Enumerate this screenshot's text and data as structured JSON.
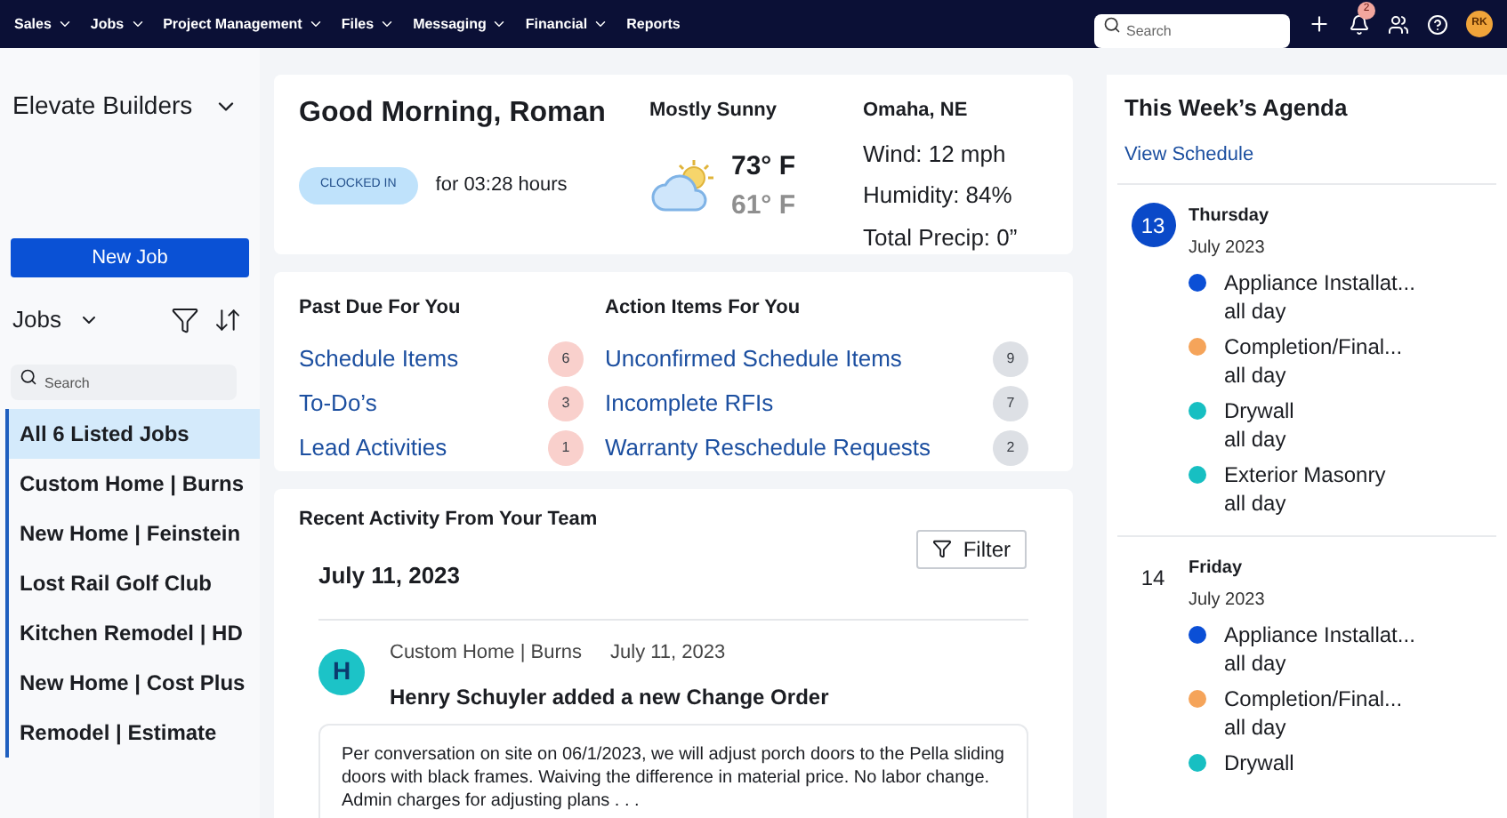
{
  "nav": {
    "items": [
      {
        "label": "Sales",
        "has_menu": true
      },
      {
        "label": "Jobs",
        "has_menu": true
      },
      {
        "label": "Project Management",
        "has_menu": true
      },
      {
        "label": "Files",
        "has_menu": true
      },
      {
        "label": "Messaging",
        "has_menu": true
      },
      {
        "label": "Financial",
        "has_menu": true
      },
      {
        "label": "Reports",
        "has_menu": false
      }
    ],
    "search": {
      "placeholder": "Search"
    },
    "notification_count": "2",
    "avatar": "RK"
  },
  "sidebar": {
    "company": "Elevate Builders",
    "new_job": "New Job",
    "jobs_label": "Jobs",
    "search": {
      "placeholder": "Search"
    },
    "jobs": [
      {
        "label": "All 6 Listed Jobs",
        "selected": true
      },
      {
        "label": "Custom Home | Burns",
        "selected": false
      },
      {
        "label": "New Home | Feinstein",
        "selected": false
      },
      {
        "label": "Lost Rail Golf Club",
        "selected": false
      },
      {
        "label": "Kitchen Remodel | HD",
        "selected": false
      },
      {
        "label": "New Home | Cost Plus",
        "selected": false
      },
      {
        "label": "Remodel | Estimate",
        "selected": false
      }
    ]
  },
  "greeting": {
    "title": "Good Morning, Roman",
    "status": "CLOCKED IN",
    "duration": "for 03:28 hours"
  },
  "weather": {
    "condition": "Mostly Sunny",
    "high": "73° F",
    "low": "61° F",
    "location": "Omaha, NE",
    "details": [
      "Wind: 12 mph",
      "Humidity: 84%",
      "Total Precip: 0”"
    ]
  },
  "summaries": [
    {
      "title": "Past Due For You",
      "items": [
        {
          "label": "Schedule Items",
          "count": "6",
          "color": "#f9d0cc"
        },
        {
          "label": "To-Do’s",
          "count": "3",
          "color": "#f9d0cc"
        },
        {
          "label": "Lead Activities",
          "count": "1",
          "color": "#f9d0cc"
        }
      ]
    },
    {
      "title": "Action Items For You",
      "items": [
        {
          "label": "Unconfirmed Schedule Items",
          "count": "9",
          "color": "#dde0e5"
        },
        {
          "label": "Incomplete RFIs",
          "count": "7",
          "color": "#dde0e5"
        },
        {
          "label": "Warranty Reschedule Requests",
          "count": "2",
          "color": "#dde0e5"
        }
      ]
    }
  ],
  "activity": {
    "title": "Recent Activity From Your Team",
    "filter": "Filter",
    "date": "July 11, 2023",
    "entries": [
      {
        "initial": "H",
        "job": "Custom Home | Burns",
        "date": "July 11, 2023",
        "headline": "Henry Schuyler added a new Change Order",
        "body": "Per conversation on site on 06/1/2023, we will adjust porch doors to the Pella sliding doors with black frames. Waiving the difference in material price. No labor change. Admin charges for adjusting plans . . ."
      }
    ]
  },
  "agenda": {
    "title": "This Week’s Agenda",
    "link": "View Schedule",
    "days": [
      {
        "day": "13",
        "weekday": "Thursday",
        "month": "July 2023",
        "selected": true,
        "events": [
          {
            "title": "Appliance Installat...",
            "time": "all day",
            "color": "#0b4fd6"
          },
          {
            "title": "Completion/Final...",
            "time": "all day",
            "color": "#f5a45a"
          },
          {
            "title": "Drywall",
            "time": "all day",
            "color": "#17bfc2"
          },
          {
            "title": "Exterior Masonry",
            "time": "all day",
            "color": "#17bfc2"
          }
        ]
      },
      {
        "day": "14",
        "weekday": "Friday",
        "month": "July 2023",
        "selected": false,
        "events": [
          {
            "title": "Appliance Installat...",
            "time": "all day",
            "color": "#0b4fd6"
          },
          {
            "title": "Completion/Final...",
            "time": "all day",
            "color": "#f5a45a"
          },
          {
            "title": "Drywall",
            "color": "#17bfc2"
          }
        ]
      }
    ]
  }
}
